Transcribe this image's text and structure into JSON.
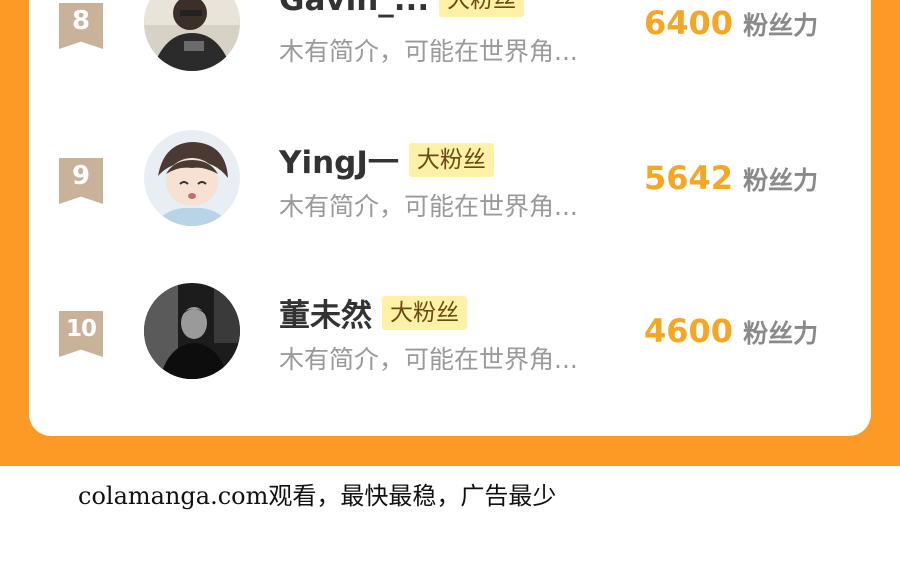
{
  "ranking": {
    "rows": [
      {
        "rank": "8",
        "name": "Gavin_...",
        "tag": "大粉丝",
        "bio": "木有简介，可能在世界角...",
        "score": "6400",
        "score_unit": "粉丝力",
        "avatar_icon": "user-avatar-photo"
      },
      {
        "rank": "9",
        "name": "YingJ一",
        "tag": "大粉丝",
        "bio": "木有简介，可能在世界角...",
        "score": "5642",
        "score_unit": "粉丝力",
        "avatar_icon": "user-avatar-illustration"
      },
      {
        "rank": "10",
        "name": "董未然",
        "tag": "大粉丝",
        "bio": "木有简介，可能在世界角...",
        "score": "4600",
        "score_unit": "粉丝力",
        "avatar_icon": "user-avatar-photo-bw"
      }
    ]
  },
  "footer": {
    "watermark": "colamanga.com观看，最快最稳，广告最少"
  },
  "colors": {
    "band": "#fd9a25",
    "score": "#f5a623",
    "badge": "#c9b29a",
    "tag_bg": "#fff1a6"
  }
}
